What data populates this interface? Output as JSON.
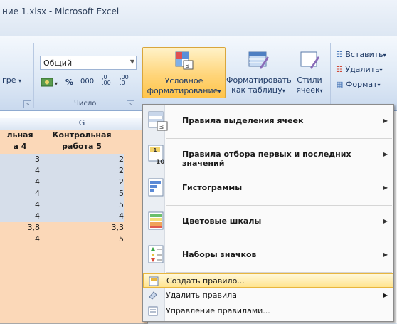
{
  "window": {
    "title": "ние 1.xlsx - Microsoft Excel"
  },
  "ribbon": {
    "left_group_fragment": "гре",
    "number_group": {
      "format_value": "Общий",
      "percent": "%",
      "thousands": "000",
      "inc_decimals": ",0\n,00",
      "dec_decimals": ",00\n,0",
      "label": "Число"
    },
    "conditional_formatting": {
      "line1": "Условное",
      "line2": "форматирование"
    },
    "format_as_table": {
      "line1": "Форматировать",
      "line2": "как таблицу"
    },
    "cell_styles": {
      "line1": "Стили",
      "line2": "ячеек"
    },
    "cells_group": {
      "insert": "Вставить",
      "delete": "Удалить",
      "format": "Формат"
    }
  },
  "sheet": {
    "column_header": "G",
    "headers": {
      "f_line1": "льная",
      "f_line2": "а 4",
      "g_line1": "Контрольная",
      "g_line2": "работа 5"
    },
    "rows": [
      {
        "f": "3",
        "g": "2"
      },
      {
        "f": "4",
        "g": "2"
      },
      {
        "f": "4",
        "g": "2"
      },
      {
        "f": "4",
        "g": "5"
      },
      {
        "f": "4",
        "g": "5"
      },
      {
        "f": "4",
        "g": "4"
      },
      {
        "f": "3,8",
        "g": "3,3"
      },
      {
        "f": "4",
        "g": "5"
      }
    ]
  },
  "menu": {
    "items": [
      {
        "label": "Правила выделения ячеек"
      },
      {
        "label": "Правила отбора первых и последних значений"
      },
      {
        "label": "Гистограммы"
      },
      {
        "label": "Цветовые шкалы"
      },
      {
        "label": "Наборы значков"
      }
    ],
    "commands": [
      {
        "label": "Создать правило..."
      },
      {
        "label": "Удалить правила"
      },
      {
        "label": "Управление правилами..."
      }
    ]
  }
}
